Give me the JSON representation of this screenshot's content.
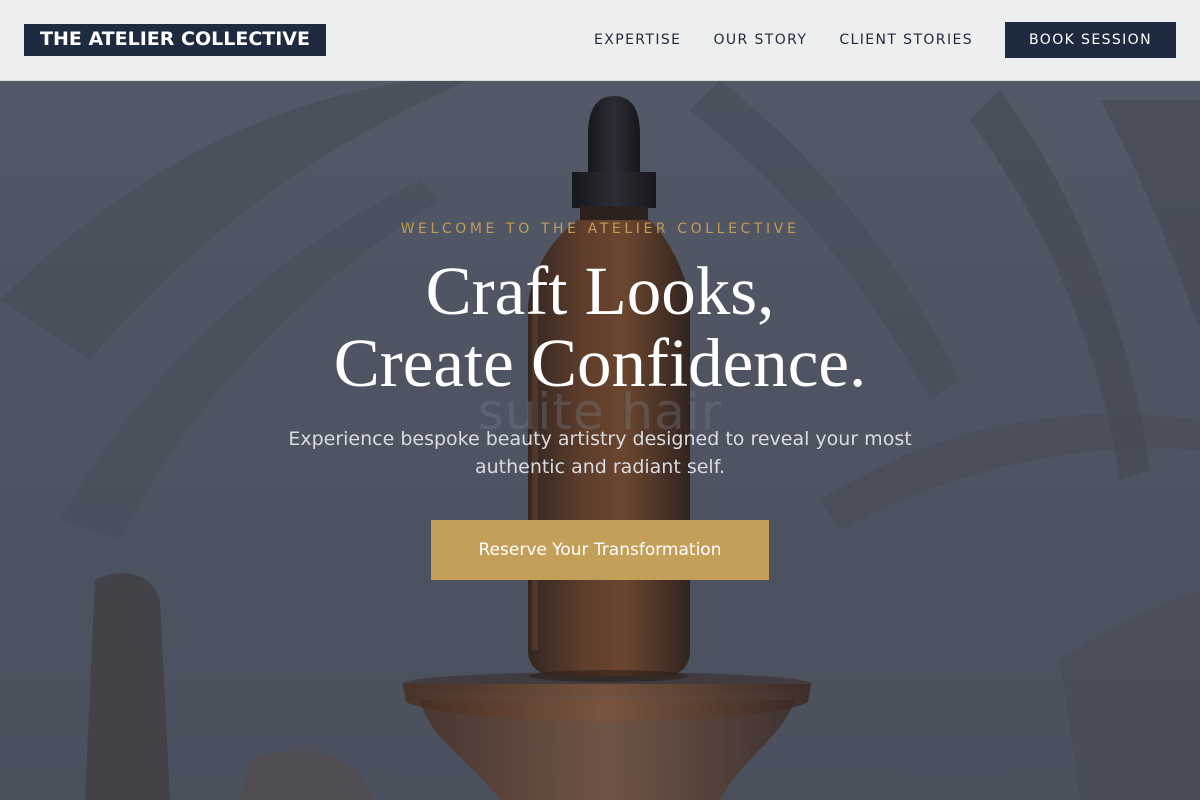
{
  "brand": {
    "logo_text": "THE ATELIER COLLECTIVE",
    "navy": "#1e2a3f",
    "gold": "#c49f5a"
  },
  "nav": {
    "links": [
      "EXPERTISE",
      "OUR STORY",
      "CLIENT STORIES"
    ],
    "book_label": "BOOK SESSION"
  },
  "hero": {
    "eyebrow": "WELCOME TO THE ATELIER COLLECTIVE",
    "headline_line1": "Craft Looks,",
    "headline_line2": "Create Confidence.",
    "background_label": "suite hair",
    "subtitle": "Experience bespoke beauty artistry designed to reveal your most authentic and radiant self.",
    "cta_label": "Reserve Your Transformation"
  }
}
